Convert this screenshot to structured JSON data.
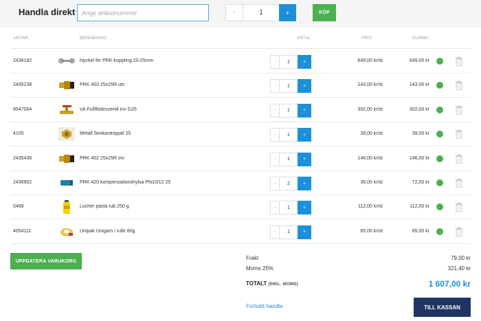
{
  "header": {
    "title": "Handla direkt",
    "search_placeholder": "Ange artikelnummer",
    "qty_minus": "-",
    "qty_value": "1",
    "qty_plus": "+",
    "buy_label": "KÖP"
  },
  "table": {
    "columns": {
      "artnr": "ARTNR.",
      "name": "BENÄMNING",
      "qty": "ANTAL",
      "price": "PRIS",
      "sum": "SUMMA"
    },
    "rows": [
      {
        "artnr": "2438182",
        "name": "Nyckel för PRK-koppling 20-25mm",
        "qty": "1",
        "price": "649,00 kr/st",
        "sum": "649,00 kr",
        "thumb": "wrench"
      },
      {
        "artnr": "2435238",
        "name": "PRK 403 25x25R utv",
        "qty": "1",
        "price": "143,00 kr/st",
        "sum": "143,00 kr",
        "thumb": "coupling"
      },
      {
        "artnr": "8547064",
        "name": "VA Fullflödesventil inv G25",
        "qty": "1",
        "price": "302,00 kr/st",
        "sum": "302,00 kr",
        "thumb": "valve"
      },
      {
        "artnr": "4105",
        "name": "Metall Sexkantnippel 25",
        "qty": "1",
        "price": "39,00 kr/st",
        "sum": "39,00 kr",
        "thumb": "nipple"
      },
      {
        "artnr": "2435436",
        "name": "PRK 402 25x25R inv",
        "qty": "1",
        "price": "146,00 kr/st",
        "sum": "146,00 kr",
        "thumb": "coupling"
      },
      {
        "artnr": "2436902",
        "name": "PRK 420 kompensationshylsa PN10/12 25",
        "qty": "2",
        "price": "36,00 kr/st",
        "sum": "72,00 kr",
        "thumb": "sleeve"
      },
      {
        "artnr": "5468",
        "name": "Locher pasta tub 250 g",
        "qty": "1",
        "price": "112,00 kr/st",
        "sum": "112,00 kr",
        "thumb": "tube"
      },
      {
        "artnr": "4054111",
        "name": "Unipak Unigarn i rulle 80g",
        "qty": "1",
        "price": "65,00 kr/st",
        "sum": "65,00 kr",
        "thumb": "yarn"
      }
    ],
    "qty_minus": "-",
    "qty_plus": "+"
  },
  "actions": {
    "update_label": "UPPDATERA VARUKORG",
    "continue_label": "Fortsätt handla",
    "checkout_label": "TILL KASSAN"
  },
  "totals": {
    "shipping_label": "Frakt",
    "shipping_value": "79,00 kr",
    "vat_label": "Moms 25%",
    "vat_value": "321,40 kr",
    "total_label": "TOTALT",
    "total_note": "(INKL. MOMS)",
    "total_value": "1 607,00 kr"
  },
  "colors": {
    "accent_blue": "#1e90d8",
    "green": "#4caf50",
    "navy": "#1f3460"
  }
}
